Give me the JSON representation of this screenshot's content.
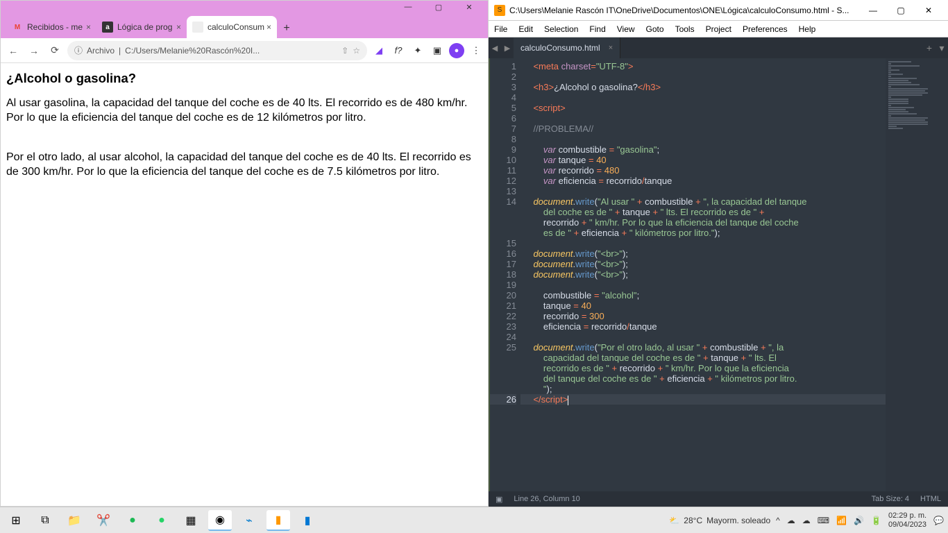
{
  "chrome": {
    "tabs": [
      {
        "title": "Recibidos - me",
        "favicon_bg": "#fff",
        "favicon_text": "M",
        "favicon_color": "#ea4335"
      },
      {
        "title": "Lógica de prog",
        "favicon_bg": "#333",
        "favicon_text": "a",
        "favicon_color": "#fff"
      },
      {
        "title": "calculoConsum",
        "favicon_bg": "#eee",
        "favicon_text": "",
        "favicon_color": "#999",
        "active": true
      }
    ],
    "url_prefix": "Archivo",
    "url": "C:/Users/Melanie%20Rascón%20I...",
    "page": {
      "heading": "¿Alcohol o gasolina?",
      "p1": "Al usar gasolina, la capacidad del tanque del coche es de 40 lts. El recorrido es de 480 km/hr. Por lo que la eficiencia del tanque del coche es de 12 kilómetros por litro.",
      "p2": "Por el otro lado, al usar alcohol, la capacidad del tanque del coche es de 40 lts. El recorrido es de 300 km/hr. Por lo que la eficiencia del tanque del coche es de 7.5 kilómetros por litro."
    }
  },
  "sublime": {
    "title": "C:\\Users\\Melanie Rascón IT\\OneDrive\\Documentos\\ONE\\Lógica\\calculoConsumo.html - S...",
    "menu": [
      "File",
      "Edit",
      "Selection",
      "Find",
      "View",
      "Goto",
      "Tools",
      "Project",
      "Preferences",
      "Help"
    ],
    "tab": "calculoConsumo.html",
    "status_left": "Line 26, Column 10",
    "status_tab": "Tab Size: 4",
    "status_lang": "HTML",
    "lines": [
      1,
      2,
      3,
      4,
      5,
      6,
      7,
      8,
      9,
      10,
      11,
      12,
      13,
      14,
      "",
      "",
      "",
      15,
      16,
      17,
      18,
      19,
      20,
      21,
      22,
      23,
      24,
      25,
      "",
      "",
      "",
      "",
      26
    ],
    "current_line": 26
  },
  "taskbar": {
    "weather_temp": "28°C",
    "weather_cond": "Mayorm. soleado",
    "time": "02:29 p. m.",
    "date": "09/04/2023"
  }
}
